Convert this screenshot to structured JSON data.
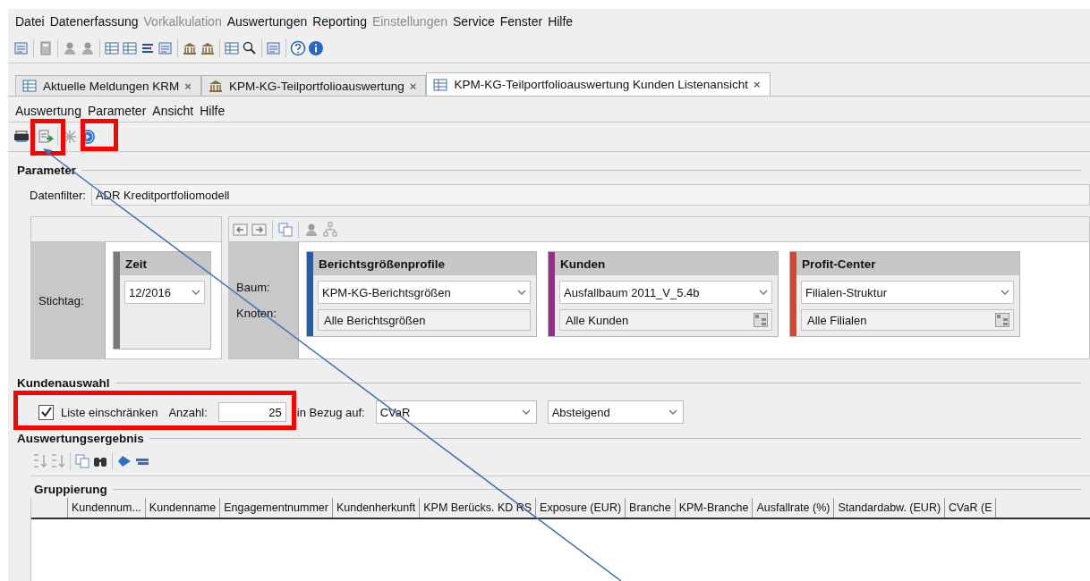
{
  "menu": [
    {
      "label": "Datei",
      "disabled": false
    },
    {
      "label": "Datenerfassung",
      "disabled": false
    },
    {
      "label": "Vorkalkulation",
      "disabled": true
    },
    {
      "label": "Auswertungen",
      "disabled": false
    },
    {
      "label": "Reporting",
      "disabled": false
    },
    {
      "label": "Einstellungen",
      "disabled": true
    },
    {
      "label": "Service",
      "disabled": false
    },
    {
      "label": "Fenster",
      "disabled": false
    },
    {
      "label": "Hilfe",
      "disabled": false
    }
  ],
  "tabs": [
    {
      "label": "Aktuelle Meldungen KRM",
      "close": "×",
      "selected": false
    },
    {
      "label": "KPM-KG-Teilportfolioauswertung",
      "close": "×",
      "selected": false
    },
    {
      "label": "KPM-KG-Teilportfolioauswertung Kunden Listenansicht",
      "close": "×",
      "selected": true
    }
  ],
  "submenu": [
    "Auswertung",
    "Parameter",
    "Ansicht",
    "Hilfe"
  ],
  "parameter": {
    "title": "Parameter",
    "filter_label": "Datenfilter:",
    "filter_value": "ADR Kreditportfoliomodell",
    "date_label": "Stichtag:",
    "time_card": {
      "title": "Zeit",
      "color": "#7a7a7a",
      "value": "12/2016"
    },
    "tree_label": "Baum:",
    "node_label": "Knoten:",
    "cards": [
      {
        "title": "Berichtsgrößenprofile",
        "color": "#1f5fa8",
        "tree": "KPM-KG-Berichtsgrößen",
        "node": "Alle Berichtsgrößen"
      },
      {
        "title": "Kunden",
        "color": "#9b2a8e",
        "tree": "Ausfallbaum 2011_V_5.4b",
        "node": "Alle Kunden"
      },
      {
        "title": "Profit-Center",
        "color": "#d9432b",
        "tree": "Filialen-Struktur",
        "node": "Alle Filialen"
      }
    ]
  },
  "kundenauswahl": {
    "title": "Kundenauswahl",
    "limit_label": "Liste einschränken",
    "checked": true,
    "count_label": "Anzahl:",
    "count": "25",
    "ref_label": "in Bezug auf:",
    "ref_value": "CVaR",
    "order_value": "Absteigend"
  },
  "result": {
    "title": "Auswertungsergebnis",
    "group_title": "Gruppierung",
    "columns": [
      "",
      "Kundennum...",
      "Kundenname",
      "Engagementnummer",
      "Kundenherkunft",
      "KPM Berücks. KD RS",
      "Exposure (EUR)",
      "Branche",
      "KPM-Branche",
      "Ausfallrate (%)",
      "Standardabw. (EUR)",
      "CVaR (E"
    ]
  }
}
